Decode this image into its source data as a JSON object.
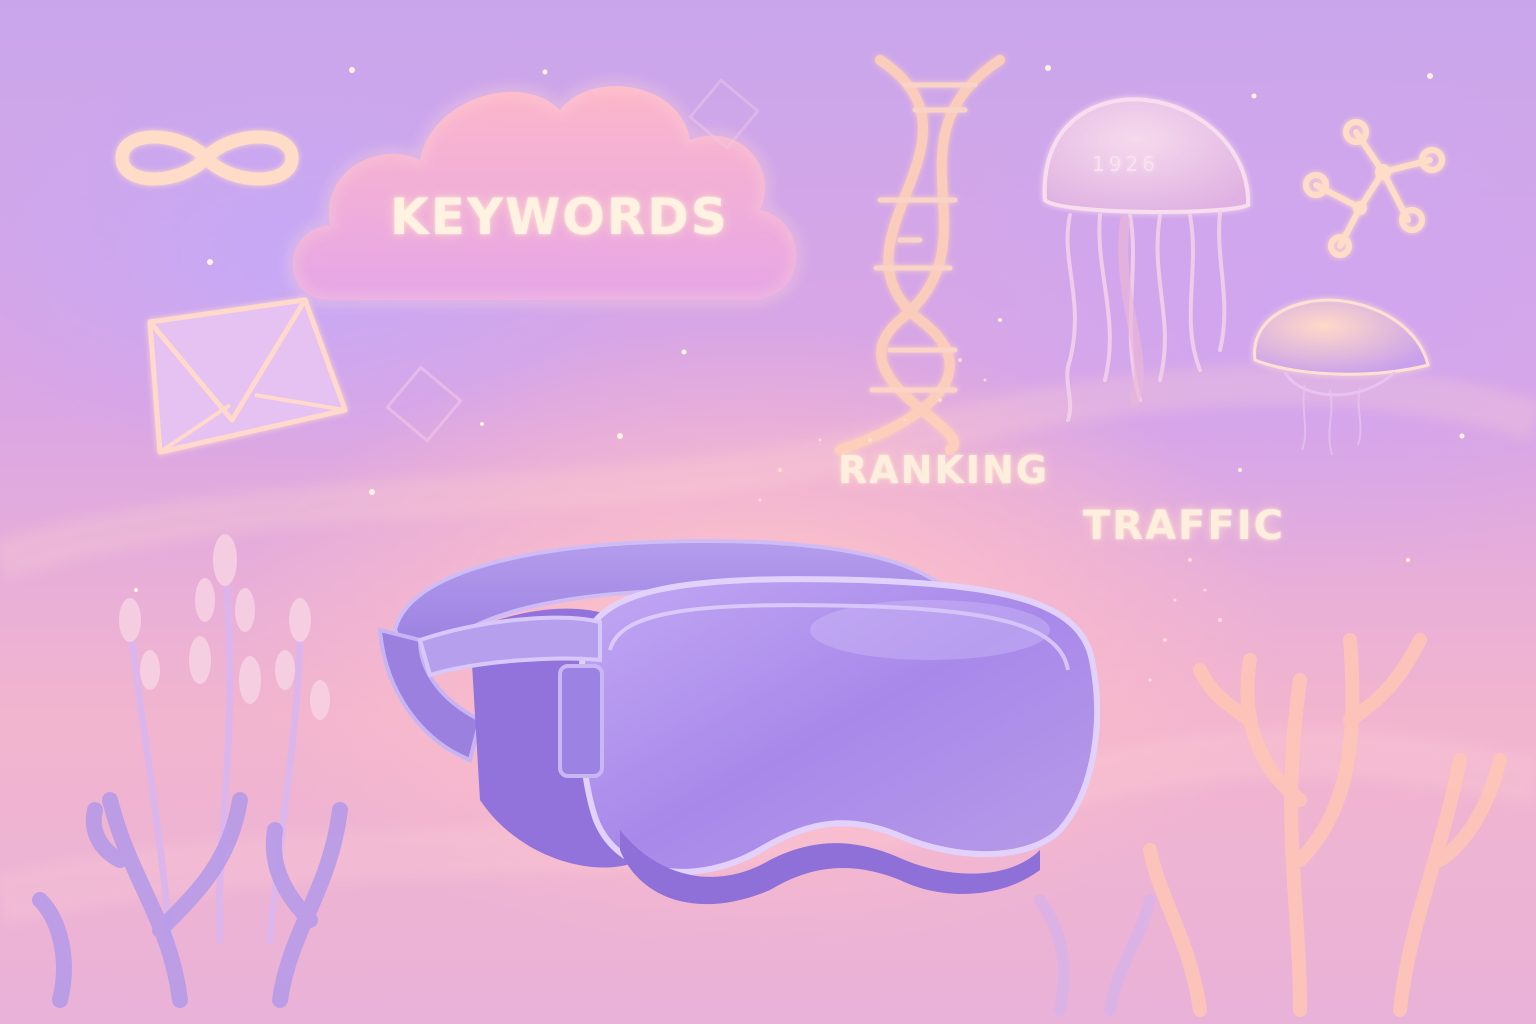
{
  "labels": {
    "keywords": "KEYWORDS",
    "ranking": "RANKING",
    "traffic": "TRAFFIC",
    "jellyfish_number": "1926"
  },
  "icons": [
    "infinity-icon",
    "cloud-icon",
    "envelope-icon",
    "dna-helix-icon",
    "jellyfish-icon",
    "molecule-icon",
    "vr-headset-icon",
    "seaweed-plant-icon",
    "coral-icon"
  ],
  "colors": {
    "background_top": "#c9a6ec",
    "background_glow": "#ffc6c8",
    "headset": "#a88ae6",
    "label_text": "#fdeedd"
  }
}
